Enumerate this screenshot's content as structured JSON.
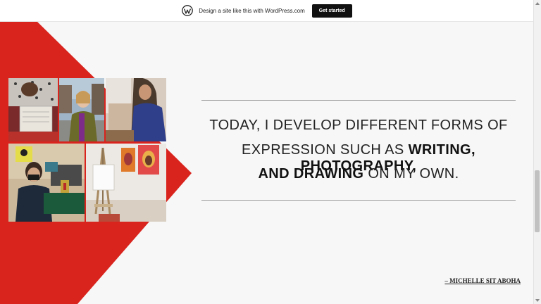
{
  "wp_banner": {
    "logo_icon": "wordpress-logo-icon",
    "text": "Design a site like this with WordPress.com",
    "button_label": "Get started"
  },
  "colors": {
    "accent_red": "#d9231d",
    "background": "#f7f7f7",
    "rule": "#9a9a9a"
  },
  "collage": {
    "photos": [
      {
        "name": "cat-and-journal-photo"
      },
      {
        "name": "woman-on-street-photo"
      },
      {
        "name": "woman-drawing-photo"
      },
      {
        "name": "woman-at-radio-station-photo"
      },
      {
        "name": "easel-and-paintings-photo"
      }
    ]
  },
  "quote": {
    "line1": "TODAY, I DEVELOP DIFFERENT FORMS OF",
    "line2_prefix": "EXPRESSION SUCH AS ",
    "line2_bold": "WRITING, PHOTOGRAPHY,",
    "line3_bold": "AND DRAWING",
    "line3_suffix": " ON MY OWN."
  },
  "author": "– MICHELLE SIT ABOHA"
}
